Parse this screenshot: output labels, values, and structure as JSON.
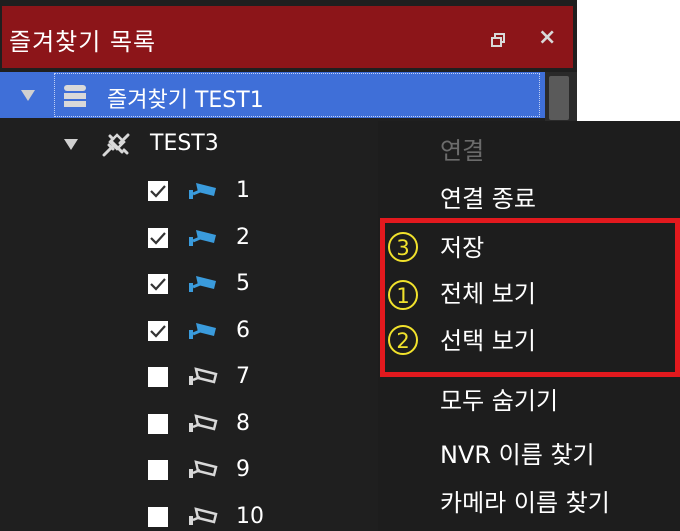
{
  "panel": {
    "title": "즐겨찾기 목록",
    "close_glyph": "×",
    "restore_icon": "restore-window-icon"
  },
  "tree": {
    "root": {
      "label": "즐겨찾기 TEST1",
      "icon": "stack-icon"
    },
    "group": {
      "label": "TEST3",
      "icon": "network-plug-icon"
    },
    "cameras": [
      {
        "label": "1",
        "checked": true,
        "active": true
      },
      {
        "label": "2",
        "checked": true,
        "active": true
      },
      {
        "label": "5",
        "checked": true,
        "active": true
      },
      {
        "label": "6",
        "checked": true,
        "active": true
      },
      {
        "label": "7",
        "checked": false,
        "active": false
      },
      {
        "label": "8",
        "checked": false,
        "active": false
      },
      {
        "label": "9",
        "checked": false,
        "active": false
      },
      {
        "label": "10",
        "checked": false,
        "active": false
      }
    ]
  },
  "context_menu": {
    "items": [
      {
        "label": "연결",
        "enabled": false
      },
      {
        "label": "연결 종료",
        "enabled": true
      },
      {
        "label": "저장",
        "enabled": true
      },
      {
        "label": "전체 보기",
        "enabled": true
      },
      {
        "label": "선택 보기",
        "enabled": true
      },
      {
        "label": "모두 숨기기",
        "enabled": true
      },
      {
        "label": "NVR 이름 찾기",
        "enabled": true
      },
      {
        "label": "카메라 이름 찾기",
        "enabled": true
      }
    ]
  },
  "annotations": {
    "markers": [
      "3",
      "1",
      "2"
    ],
    "highlight_color": "#e2191e",
    "marker_color": "#f1e22c"
  },
  "colors": {
    "title_bg": "#8c1519",
    "selection_bg": "#3f6fd8",
    "camera_active": "#3a9bdc",
    "camera_inactive": "#d8d8d8"
  }
}
